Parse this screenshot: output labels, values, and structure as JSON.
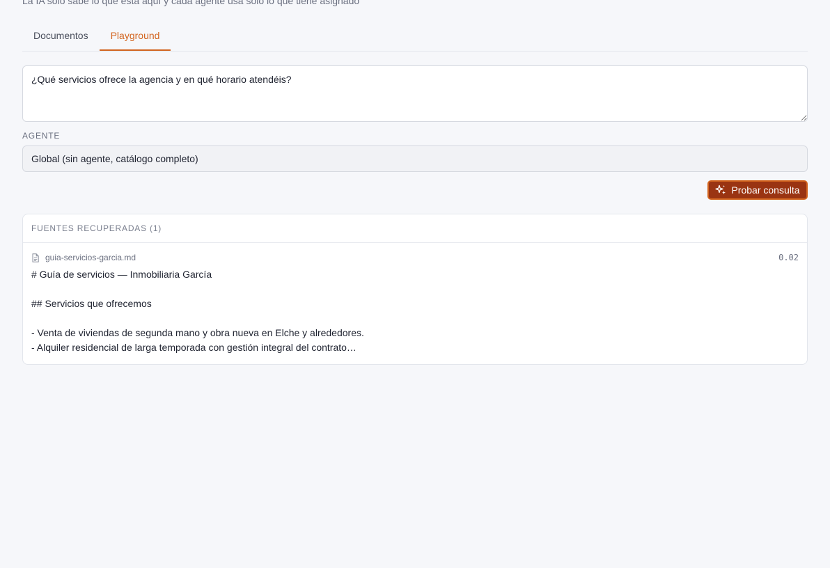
{
  "header": {
    "subtitle": "La IA solo sabe lo que está aquí y cada agente usa solo lo que tiene asignado"
  },
  "tabs": [
    {
      "label": "Documentos",
      "active": false
    },
    {
      "label": "Playground",
      "active": true
    }
  ],
  "query": {
    "value": "¿Qué servicios ofrece la agencia y en qué horario atendéis?"
  },
  "agent": {
    "label": "Agente",
    "selected": "Global (sin agente, catálogo completo)"
  },
  "actions": {
    "test_label": "Probar consulta"
  },
  "sources": {
    "header": "Fuentes recuperadas (1)",
    "items": [
      {
        "file": "guia-servicios-garcia.md",
        "score": "0.02",
        "snippet": "# Guía de servicios — Inmobiliaria García\n\n## Servicios que ofrecemos\n\n- Venta de viviendas de segunda mano y obra nueva en Elche y alrededores.\n- Alquiler residencial de larga temporada con gestión integral del contrato…"
      }
    ]
  },
  "colors": {
    "accent": "#d2641f",
    "button_bg": "#9a3412"
  }
}
